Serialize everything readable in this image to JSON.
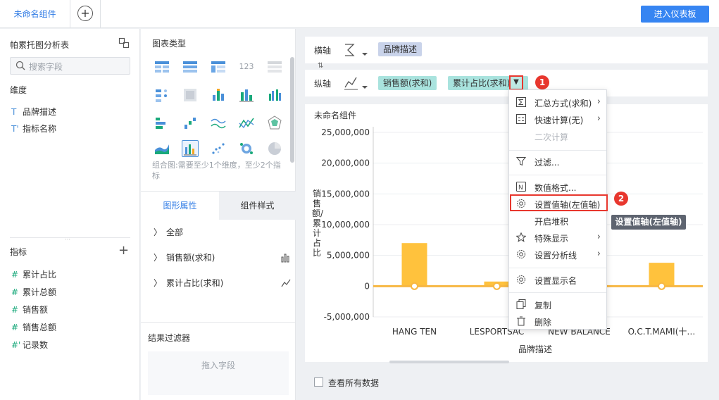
{
  "topbar": {
    "tab_label": "未命名组件",
    "add_tab_glyph": "+",
    "enter_dashboard_label": "进入仪表板"
  },
  "left_panel": {
    "title": "帕累托图分析表",
    "search_placeholder": "搜索字段",
    "dimension_header": "维度",
    "dimensions": [
      {
        "icon": "T",
        "label": "品牌描述"
      },
      {
        "icon": "T'",
        "label": "指标名称"
      }
    ],
    "metric_header": "指标",
    "metrics": [
      {
        "icon": "#",
        "label": "累计占比"
      },
      {
        "icon": "#",
        "label": "累计总额"
      },
      {
        "icon": "#",
        "label": "销售额"
      },
      {
        "icon": "#",
        "label": "销售总额"
      },
      {
        "icon": "#'",
        "label": "记录数"
      }
    ]
  },
  "chart_types": {
    "header": "图表类型",
    "hint": "组合图:需要至少1个维度，至少2个指标",
    "number_icon_text": "123"
  },
  "props": {
    "tab_shape": "图形属性",
    "tab_style": "组件样式",
    "items": [
      "全部",
      "销售额(求和)",
      "累计占比(求和)"
    ]
  },
  "filter": {
    "header": "结果过滤器",
    "drop_hint": "拖入字段"
  },
  "axes": {
    "x_label": "横轴",
    "x_pill": "品牌描述",
    "y_label": "纵轴",
    "y_pills": [
      "销售额(求和)",
      "累计占比(求和)"
    ]
  },
  "chart": {
    "card_title": "未命名组件",
    "ylabel": "销售额/累计占比",
    "xlabel": "品牌描述",
    "show_all_label": "查看所有数据"
  },
  "chart_data": {
    "type": "bar",
    "categories": [
      "HANG TEN",
      "LESPORTSAC",
      "NEW BALANCE",
      "O.C.T.MAMI(十…"
    ],
    "category_labels_visible": [
      "HANG TEN",
      "LESPORTSAC",
      "NEW BALANCE",
      "O.C.T.MAMI(十…"
    ],
    "series": [
      {
        "name": "销售额(求和)",
        "values": [
          7000000,
          750000,
          300000,
          3800000
        ]
      },
      {
        "name": "累计占比(求和)",
        "values": [
          0,
          0,
          0,
          0
        ]
      }
    ],
    "y_ticks": [
      "25,000,000",
      "20,000,000",
      "15,000,000",
      "10,000,000",
      "5,000,000",
      "0",
      "-5,000,000"
    ],
    "ylim": [
      -5000000,
      25000000
    ],
    "bar_color": "#ffc23d",
    "line_color": "#f7b742",
    "grid": true
  },
  "menu": {
    "items": [
      {
        "icon": "sigma",
        "label": "汇总方式(求和)",
        "arrow": true,
        "disabled": false
      },
      {
        "icon": "calc",
        "label": "快速计算(无)",
        "arrow": true,
        "disabled": false
      },
      {
        "icon": "",
        "label": "二次计算",
        "arrow": false,
        "disabled": true
      },
      {
        "icon": "filter",
        "label": "过滤...",
        "arrow": false,
        "disabled": false
      },
      {
        "icon": "number-format",
        "label": "数值格式...",
        "arrow": false,
        "disabled": false
      },
      {
        "icon": "gear",
        "label": "设置值轴(左值轴)",
        "arrow": false,
        "disabled": false
      },
      {
        "icon": "",
        "label": "开启堆积",
        "arrow": false,
        "disabled": false
      },
      {
        "icon": "star",
        "label": "特殊显示",
        "arrow": true,
        "disabled": false
      },
      {
        "icon": "gear",
        "label": "设置分析线",
        "arrow": true,
        "disabled": false
      },
      {
        "icon": "gear",
        "label": "设置显示名",
        "arrow": false,
        "disabled": false
      },
      {
        "icon": "copy",
        "label": "复制",
        "arrow": false,
        "disabled": false
      },
      {
        "icon": "trash",
        "label": "删除",
        "arrow": false,
        "disabled": false
      }
    ],
    "tooltip": "设置值轴(左值轴)",
    "badges": [
      "1",
      "2"
    ]
  },
  "colors": {
    "accent": "#3685f2",
    "highlight": "#e8372e",
    "pill_bg": "#a9e3de",
    "pill_x_bg": "#c9d3ea"
  }
}
